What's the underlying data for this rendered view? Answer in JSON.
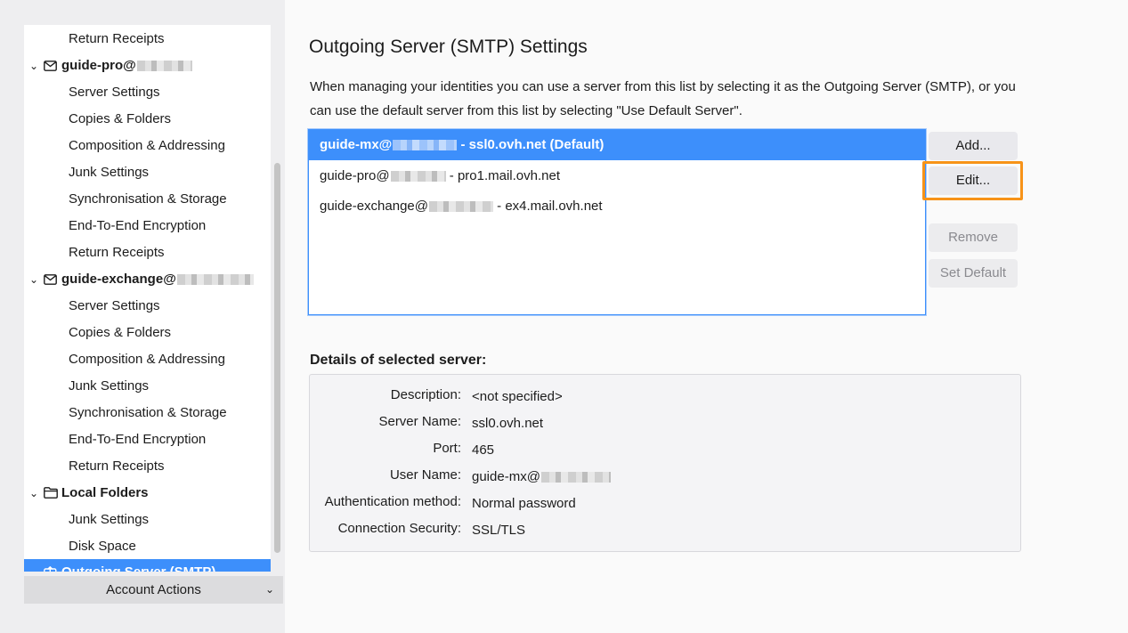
{
  "sidebar": {
    "items": [
      {
        "type": "child",
        "label": "Return Receipts"
      },
      {
        "type": "account",
        "label": "guide-pro@",
        "icon": "mail-icon"
      },
      {
        "type": "child",
        "label": "Server Settings"
      },
      {
        "type": "child",
        "label": "Copies & Folders"
      },
      {
        "type": "child",
        "label": "Composition & Addressing"
      },
      {
        "type": "child",
        "label": "Junk Settings"
      },
      {
        "type": "child",
        "label": "Synchronisation & Storage"
      },
      {
        "type": "child",
        "label": "End-To-End Encryption"
      },
      {
        "type": "child",
        "label": "Return Receipts"
      },
      {
        "type": "account",
        "label": "guide-exchange@",
        "icon": "mail-icon"
      },
      {
        "type": "child",
        "label": "Server Settings"
      },
      {
        "type": "child",
        "label": "Copies & Folders"
      },
      {
        "type": "child",
        "label": "Composition & Addressing"
      },
      {
        "type": "child",
        "label": "Junk Settings"
      },
      {
        "type": "child",
        "label": "Synchronisation & Storage"
      },
      {
        "type": "child",
        "label": "End-To-End Encryption"
      },
      {
        "type": "child",
        "label": "Return Receipts"
      },
      {
        "type": "account",
        "label": "Local Folders",
        "icon": "folder-icon"
      },
      {
        "type": "child",
        "label": "Junk Settings"
      },
      {
        "type": "child",
        "label": "Disk Space"
      },
      {
        "type": "selected",
        "label": "Outgoing Server (SMTP)",
        "icon": "outgoing-server-icon"
      }
    ],
    "account_actions_label": "Account Actions"
  },
  "main": {
    "title": "Outgoing Server (SMTP) Settings",
    "description": "When managing your identities you can use a server from this list by selecting it as the Outgoing Server (SMTP), or you can use the default server from this list by selecting \"Use Default Server\".",
    "servers": [
      {
        "user": "guide-mx@",
        "server": " - ssl0.ovh.net (Default)",
        "selected": true
      },
      {
        "user": "guide-pro@",
        "server": " - pro1.mail.ovh.net",
        "selected": false
      },
      {
        "user": "guide-exchange@",
        "server": " - ex4.mail.ovh.net",
        "selected": false
      }
    ],
    "buttons": {
      "add": "Add...",
      "edit": "Edit...",
      "remove": "Remove",
      "set_default": "Set Default"
    },
    "details": {
      "title": "Details of selected server:",
      "description_label": "Description:",
      "description_value": "<not specified>",
      "server_name_label": "Server Name:",
      "server_name_value": "ssl0.ovh.net",
      "port_label": "Port:",
      "port_value": "465",
      "user_name_label": "User Name:",
      "user_name_value": "guide-mx@",
      "auth_label": "Authentication method:",
      "auth_value": "Normal password",
      "security_label": "Connection Security:",
      "security_value": "SSL/TLS"
    }
  },
  "colors": {
    "accent": "#3d8ffb",
    "highlight": "#f79318"
  }
}
